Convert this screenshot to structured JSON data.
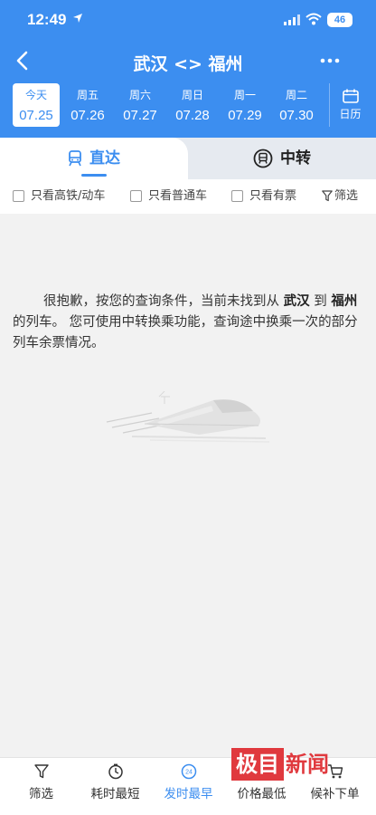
{
  "status_bar": {
    "time": "12:49",
    "battery": "46"
  },
  "nav": {
    "title": "武汉 <> 福州"
  },
  "dates": [
    {
      "dow": "今天",
      "date": "07.25",
      "selected": true
    },
    {
      "dow": "周五",
      "date": "07.26"
    },
    {
      "dow": "周六",
      "date": "07.27"
    },
    {
      "dow": "周日",
      "date": "07.28"
    },
    {
      "dow": "周一",
      "date": "07.29"
    },
    {
      "dow": "周二",
      "date": "07.30"
    }
  ],
  "calendar_label": "日历",
  "tabs": {
    "direct": "直达",
    "transfer": "中转"
  },
  "filters": {
    "high_speed": "只看高铁/动车",
    "regular": "只看普通车",
    "available": "只看有票",
    "filter_button": "筛选"
  },
  "message": {
    "part1": "很抱歉，按您的查询条件，当前未找到从 ",
    "from": "武汉",
    "part2": " 到 ",
    "to": "福州",
    "part3": " 的列车。 您可使用中转换乘功能，查询途中换乘一次的部分列车余票情况。"
  },
  "bottom_bar": {
    "filter": "筛选",
    "shortest": "耗时最短",
    "earliest": "发时最早",
    "earliest_badge": "24",
    "cheapest": "价格最低",
    "waitlist": "候补下单"
  },
  "watermark": {
    "box": "极目",
    "text": "新闻"
  },
  "colors": {
    "primary": "#3c8ef0",
    "watermark": "#e0393e"
  }
}
